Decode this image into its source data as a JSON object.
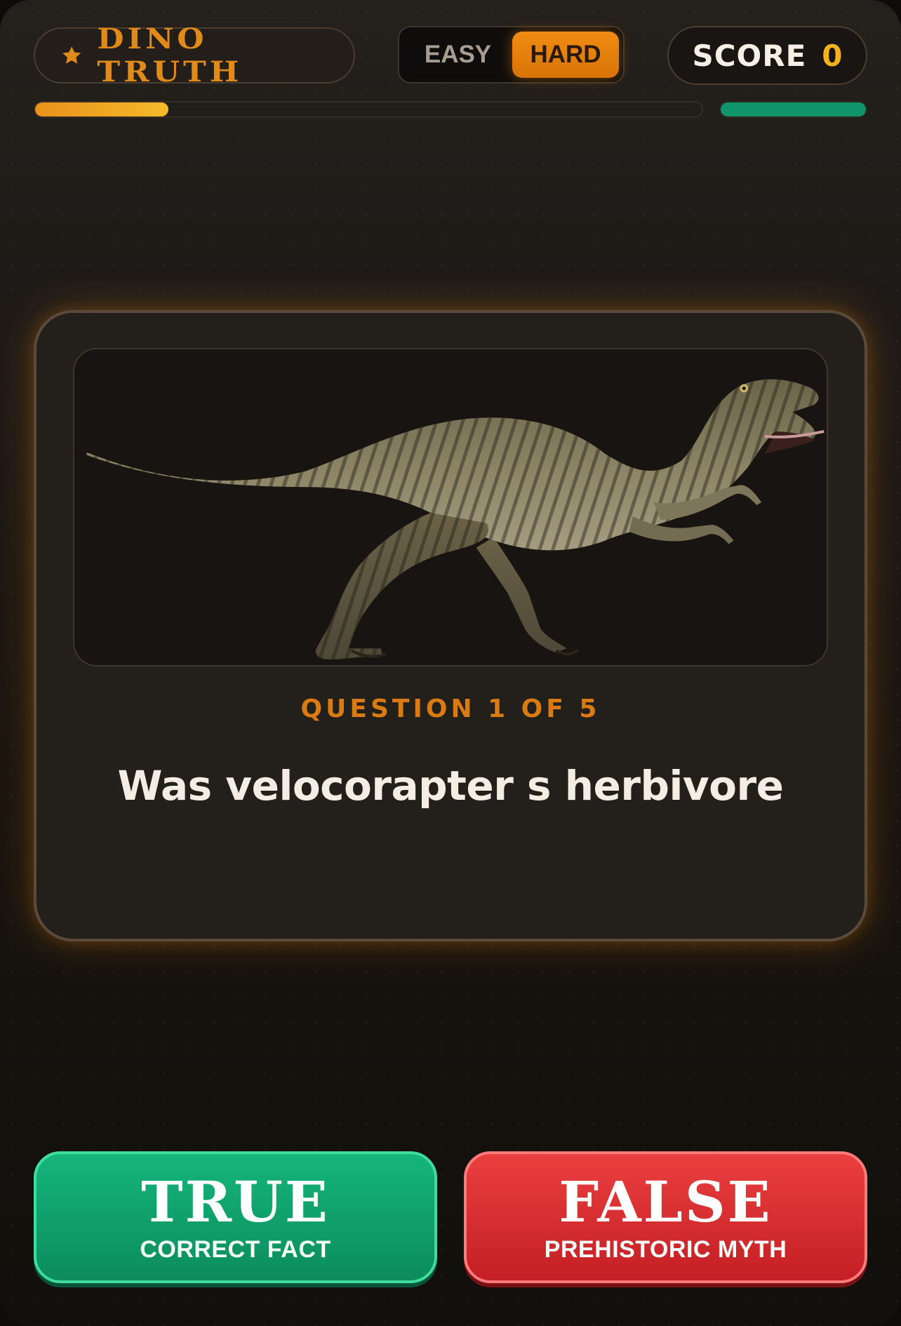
{
  "header": {
    "brand_title": "DINO TRUTH",
    "difficulty": {
      "easy_label": "EASY",
      "hard_label": "HARD",
      "selected": "HARD"
    },
    "score_label": "SCORE",
    "score_value": "0",
    "progress_fraction": 0.2,
    "side_fill_fraction": 1.0
  },
  "question": {
    "counter": "QUESTION 1 OF 5",
    "text": "Was velocorapter s herbivore",
    "image": "velociraptor-image"
  },
  "answers": {
    "true_label": "TRUE",
    "true_sub": "CORRECT FACT",
    "false_label": "FALSE",
    "false_sub": "PREHISTORIC MYTH"
  },
  "icons": {
    "brand": "star-icon"
  },
  "colors": {
    "accent_orange": "#e08a1a",
    "score_yellow": "#f3b21b",
    "true_green": "#10a06e",
    "false_red": "#d9302f"
  }
}
